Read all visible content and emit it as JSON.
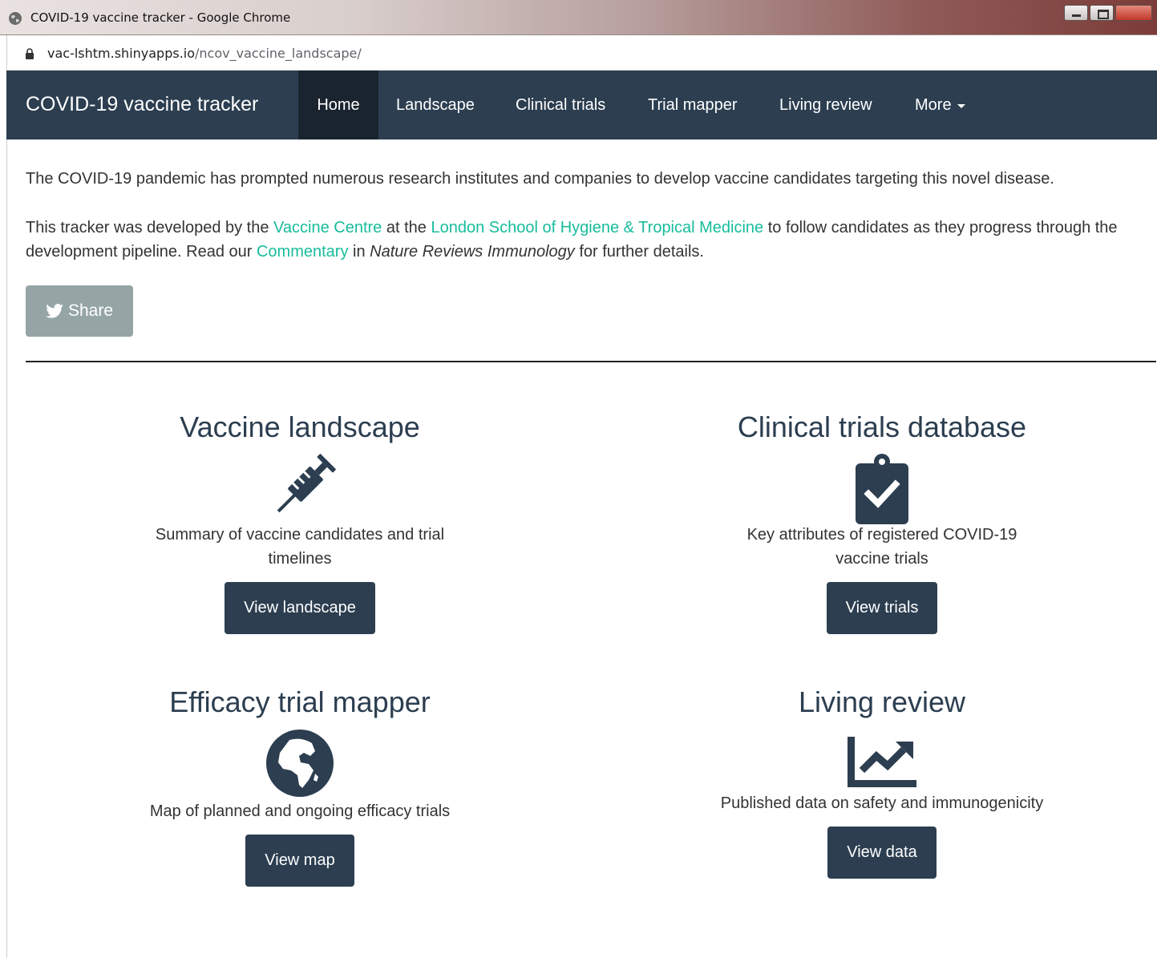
{
  "window": {
    "title": "COVID-19 vaccine tracker - Google Chrome",
    "url_host": "vac-lshtm.shinyapps.io",
    "url_path": "/ncov_vaccine_landscape/"
  },
  "navbar": {
    "brand": "COVID-19 vaccine tracker",
    "items": [
      {
        "label": "Home",
        "active": true
      },
      {
        "label": "Landscape"
      },
      {
        "label": "Clinical trials"
      },
      {
        "label": "Trial mapper"
      },
      {
        "label": "Living review"
      },
      {
        "label": "More"
      }
    ]
  },
  "intro": {
    "p1": "The COVID-19 pandemic has prompted numerous research institutes and companies to develop vaccine candidates targeting this novel disease.",
    "p2_a": "This tracker was developed by the ",
    "p2_link1": "Vaccine Centre",
    "p2_b": " at the ",
    "p2_link2": "London School of Hygiene & Tropical Medicine",
    "p2_c": " to follow candidates as they progress through the development pipeline. Read our ",
    "p2_link3": "Commentary",
    "p2_d": " in ",
    "p2_italic": "Nature Reviews Immunology",
    "p2_e": " for further details."
  },
  "share": {
    "label": "Share",
    "icon": "twitter-icon"
  },
  "cards": {
    "landscape": {
      "title": "Vaccine landscape",
      "icon": "syringe-icon",
      "desc": "Summary of vaccine candidates and trial timelines",
      "button": "View landscape"
    },
    "trials": {
      "title": "Clinical trials database",
      "icon": "clipboard-check-icon",
      "desc": "Key attributes of registered COVID-19 vaccine trials",
      "button": "View trials"
    },
    "mapper": {
      "title": "Efficacy trial mapper",
      "icon": "globe-africa-icon",
      "desc": "Map of planned and ongoing efficacy trials",
      "button": "View map"
    },
    "review": {
      "title": "Living review",
      "icon": "chart-line-icon",
      "desc": "Published data on safety and immunogenicity",
      "button": "View data"
    }
  },
  "colors": {
    "navbar": "#2c3e50",
    "navbar_active": "#1a242f",
    "link": "#18bc9c",
    "share": "#95a5a6"
  }
}
